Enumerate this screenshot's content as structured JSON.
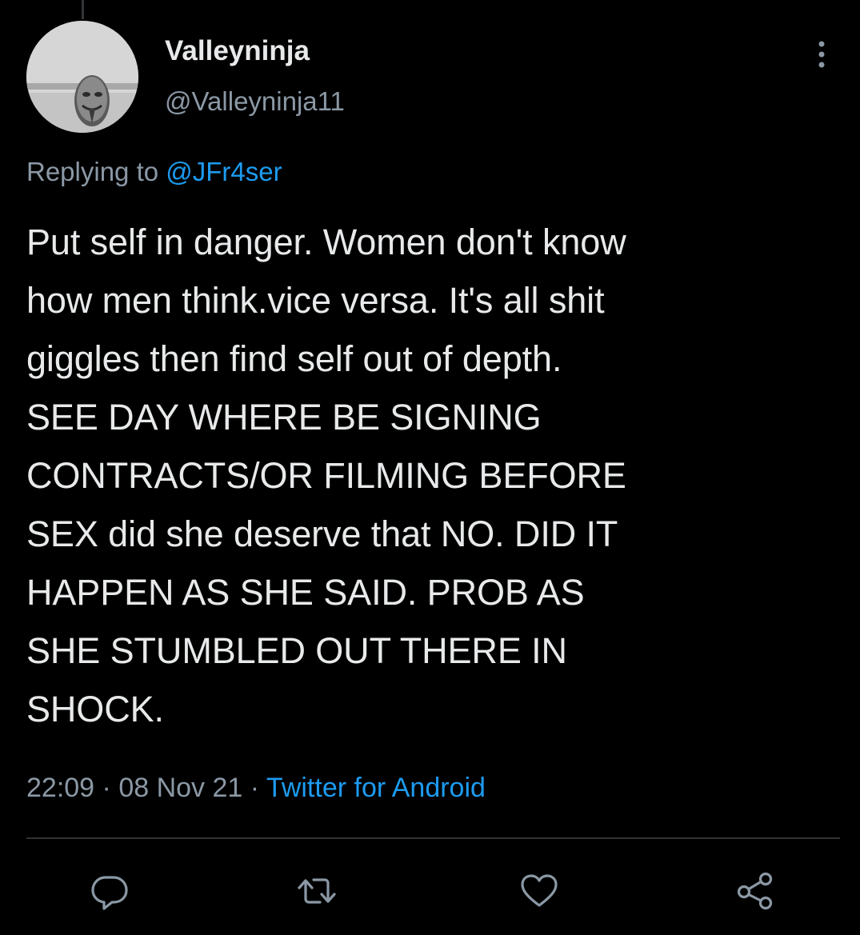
{
  "tweet": {
    "display_name": "Valleyninja",
    "handle": "@Valleyninja11",
    "replying_prefix": "Replying to ",
    "replying_to": "@JFr4ser",
    "text": "Put self in danger. Women don't know\nhow men think.vice versa. It's all shit\ngiggles then find self out of depth.\nSEE DAY WHERE BE SIGNING\nCONTRACTS/OR FILMING BEFORE\nSEX did she deserve that NO. DID IT\nHAPPEN AS SHE SAID. PROB AS\nSHE STUMBLED OUT THERE IN\nSHOCK.",
    "time": "22:09",
    "separator": " · ",
    "date": "08 Nov 21",
    "source": "Twitter for Android"
  },
  "icons": {
    "more": "more-vertical-icon",
    "reply": "reply-icon",
    "retweet": "retweet-icon",
    "like": "like-icon",
    "share": "share-icon"
  },
  "colors": {
    "background": "#000000",
    "text": "#e7e9ea",
    "secondary": "#8b98a5",
    "accent": "#1d9bf0",
    "divider": "#2f3336"
  }
}
